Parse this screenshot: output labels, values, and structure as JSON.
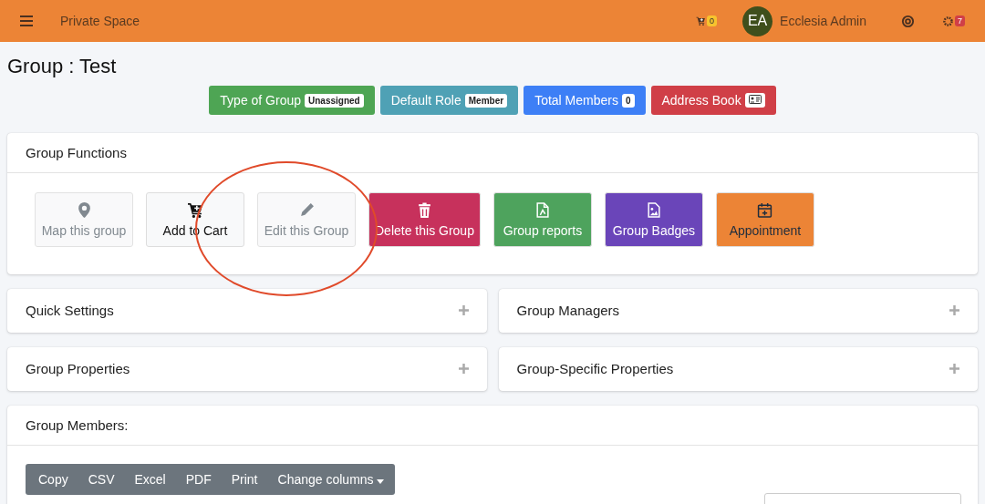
{
  "navbar": {
    "brand": "Private Space",
    "cart_count": "0",
    "avatar_initials": "EA",
    "user_name": "Ecclesia Admin",
    "notifications_count": "7"
  },
  "title": "Group : Test",
  "summary_buttons": [
    {
      "label": "Type of Group",
      "badge": "Unassigned",
      "color": "#4ea554",
      "kind": "text"
    },
    {
      "label": "Default Role",
      "badge": "Member",
      "color": "#4fa1b5",
      "kind": "text"
    },
    {
      "label": "Total Members",
      "badge": "0",
      "color": "#3d7ff6",
      "kind": "text"
    },
    {
      "label": "Address Book",
      "color": "#d03f47",
      "kind": "icon"
    }
  ],
  "group_functions": {
    "title": "Group Functions",
    "buttons": [
      {
        "label": "Map this group",
        "color": "#f8f9fa",
        "disabled": true
      },
      {
        "label": "Add to Cart",
        "color": "#f8f9fa",
        "disabled": false
      },
      {
        "label": "Edit this Group",
        "color": "#f8f9fa",
        "disabled": true
      },
      {
        "label": "Delete this Group",
        "color": "#c7315c",
        "disabled": false
      },
      {
        "label": "Group reports",
        "color": "#4ea35d",
        "disabled": false
      },
      {
        "label": "Group Badges",
        "color": "#6a45b9",
        "disabled": false
      },
      {
        "label": "Appointment",
        "color": "#ec8436",
        "disabled": false
      }
    ]
  },
  "collapsed_panels": [
    {
      "title": "Quick Settings",
      "expanded": false
    },
    {
      "title": "Group Managers",
      "expanded": false
    },
    {
      "title": "Group Properties",
      "expanded": false
    },
    {
      "title": "Group-Specific Properties",
      "expanded": false
    }
  ],
  "members": {
    "title": "Group Members:",
    "export_buttons": [
      "Copy",
      "CSV",
      "Excel",
      "PDF",
      "Print"
    ],
    "columns_button": "Change columns"
  }
}
